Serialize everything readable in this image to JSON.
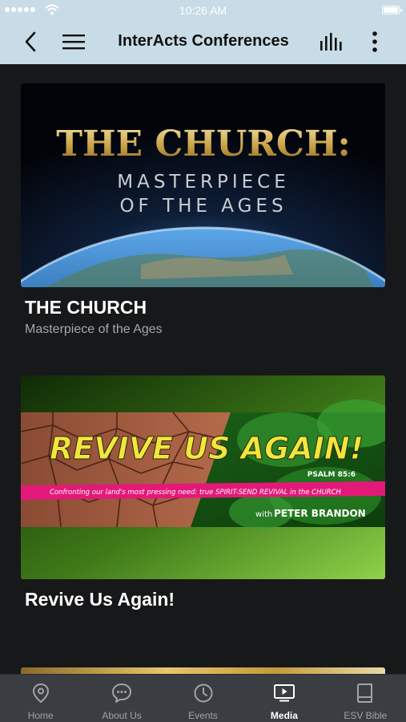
{
  "status_bar": {
    "time": "10:26 AM"
  },
  "nav": {
    "title": "InterActs Conferences"
  },
  "cards": [
    {
      "title": "THE CHURCH",
      "subtitle": "Masterpiece of the Ages",
      "banner": {
        "headline": "THE CHURCH:",
        "line1": "MASTERPIECE",
        "line2": "OF THE AGES"
      }
    },
    {
      "title": "Revive Us Again!",
      "banner": {
        "headline": "REVIVE US AGAIN!",
        "reference": "PSALM 85:6",
        "tagline": "Confronting our land's most pressing need: true SPIRIT-SEND REVIVAL in the CHURCH",
        "byline": "with",
        "speaker": "PETER BRANDON"
      }
    }
  ],
  "tabs": [
    {
      "label": "Home",
      "icon": "location-pin-icon"
    },
    {
      "label": "About Us",
      "icon": "chat-bubble-icon"
    },
    {
      "label": "Events",
      "icon": "clock-icon"
    },
    {
      "label": "Media",
      "icon": "play-screen-icon",
      "active": true
    },
    {
      "label": "ESV Bible",
      "icon": "book-icon"
    }
  ],
  "colors": {
    "header_bg": "#c7dce6",
    "content_bg": "#17181a",
    "tabbar_bg": "#3a3d41",
    "tab_inactive": "#a2a4a7",
    "tab_active": "#ffffff"
  }
}
